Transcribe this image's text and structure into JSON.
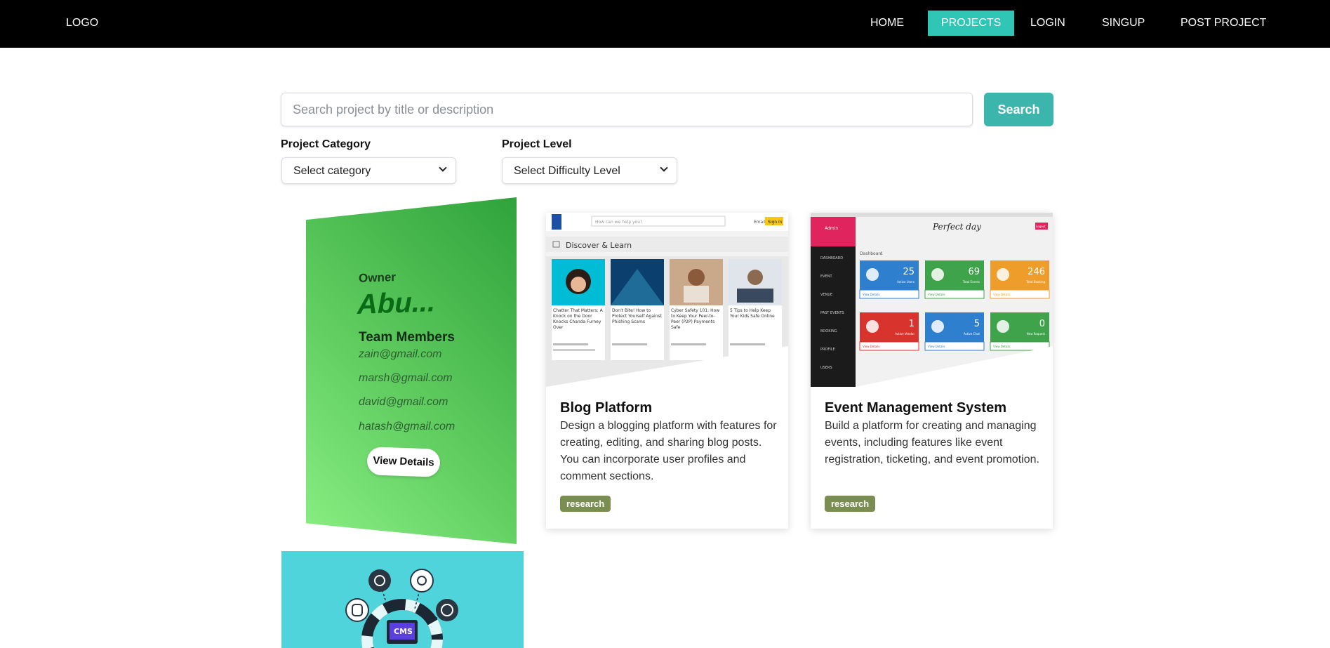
{
  "nav": {
    "logo": "LOGO",
    "items": [
      "HOME",
      "PROJECTS",
      "LOGIN",
      "SINGUP",
      "POST PROJECT"
    ],
    "active": "PROJECTS",
    "accent": "#2fc6b5"
  },
  "search": {
    "placeholder": "Search project by title or description",
    "value": "",
    "button": "Search",
    "button_color": "#3cb6ad"
  },
  "filters": {
    "category_label": "Project Category",
    "category_value": "Select category",
    "level_label": "Project Level",
    "level_value": "Select Difficulty Level"
  },
  "flip_card": {
    "owner_label": "Owner",
    "owner": "Abu...",
    "team_label": "Team Members",
    "members": [
      "zain@gmail.com",
      "marsh@gmail.com",
      "david@gmail.com",
      "hatash@gmail.com"
    ],
    "button": "View Details"
  },
  "cards": [
    {
      "title": "Blog Platform",
      "description": "Design a blogging platform with features for creating, editing, and sharing blog posts. You can incorporate user profiles and comment sections.",
      "tag": "research",
      "image": {
        "search_placeholder": "How can we help you?",
        "signin": "Sign in",
        "heading": "Discover & Learn",
        "articles": [
          "Chatter That Matters: A Knock on the Door Knocks Chanda Furney Over",
          "Don't Bite! How to Protect Yourself Against Phishing Scams",
          "Cyber Safety 101: How to Keep Your Peer-to-Peer (P2P) Payments Safe",
          "5 Tips to Help Keep Your Kids Safe Online"
        ]
      }
    },
    {
      "title": "Event Management System",
      "description": "Build a platform for creating and managing events, including features like event registration, ticketing, and event promotion.",
      "tag": "research",
      "image": {
        "logo": "Perfect day",
        "admin": "Admin",
        "dashboard": "Dashboard",
        "logout": "Logout",
        "menu": [
          "DASHBOARD",
          "EVENT",
          "VENUE",
          "PAST EVENTS",
          "BOOKING",
          "PROFILE",
          "USERS"
        ],
        "tiles": [
          {
            "value": "25",
            "label": "Active Users",
            "link": "View Details",
            "color": "#2f7fcf"
          },
          {
            "value": "69",
            "label": "Total Events",
            "link": "View Details",
            "color": "#3ea34a"
          },
          {
            "value": "246",
            "label": "Total Booking",
            "link": "View Details",
            "color": "#ef9d2a"
          },
          {
            "value": "1",
            "label": "Active Vendor",
            "link": "View Details",
            "color": "#d9332e"
          },
          {
            "value": "5",
            "label": "Active Chat",
            "link": "View Details",
            "color": "#2f7fcf"
          },
          {
            "value": "0",
            "label": "New Request",
            "link": "View Details",
            "color": "#3ea34a"
          }
        ]
      }
    }
  ],
  "cms_card": {
    "label": "CMS"
  }
}
